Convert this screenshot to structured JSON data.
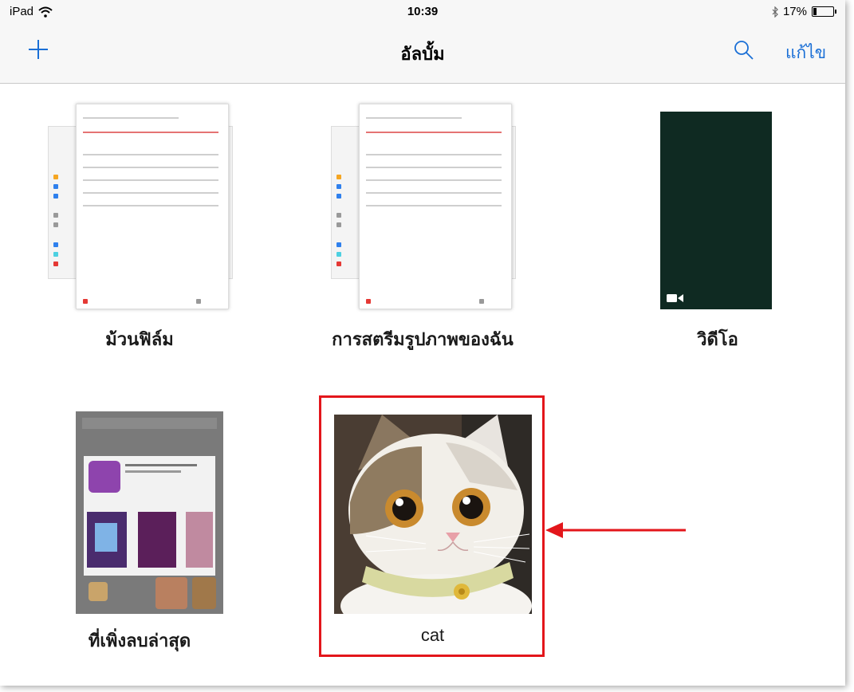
{
  "status_bar": {
    "device": "iPad",
    "time": "10:39",
    "battery_text": "17%",
    "battery_level": 0.17,
    "wifi_icon": "wifi-icon",
    "bluetooth_icon": "bluetooth-icon"
  },
  "nav_bar": {
    "title": "อัลบั้ม",
    "add_icon": "plus-icon",
    "search_icon": "search-icon",
    "edit_label": "แก้ไข"
  },
  "albums": [
    {
      "label": "ม้วนฟิล์ม"
    },
    {
      "label": "การสตรีมรูปภาพของฉัน"
    },
    {
      "label": "วิดีโอ"
    },
    {
      "label": "ที่เพิ่งลบล่าสุด"
    },
    {
      "label": "cat"
    }
  ],
  "colors": {
    "accent": "#1a6fd6",
    "highlight": "#e3161b",
    "nav_background": "#f7f7f7"
  }
}
